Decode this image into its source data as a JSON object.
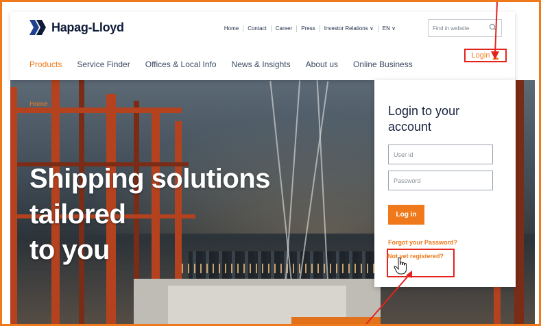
{
  "brand": {
    "name": "Hapag-Lloyd"
  },
  "top_nav": {
    "items": [
      "Home",
      "Contact",
      "Career",
      "Press",
      "Investor Relations ∨"
    ],
    "language": "EN ∨"
  },
  "search": {
    "placeholder": "Find in website",
    "icon": "search-icon"
  },
  "main_nav": {
    "items": [
      "Products",
      "Service Finder",
      "Offices & Local Info",
      "News & Insights",
      "About us",
      "Online Business"
    ],
    "active": "Products"
  },
  "login_link": {
    "label": "Login",
    "icon": "person-icon"
  },
  "hero": {
    "breadcrumb": "Home",
    "title_line1": "Shipping solutions tailored",
    "title_line2": "to you"
  },
  "login_panel": {
    "title": "Login to your account",
    "user_placeholder": "User id",
    "password_placeholder": "Password",
    "login_button": "Log in",
    "forgot_link": "Forgot your Password?",
    "register_link": "Not yet registered?"
  },
  "colors": {
    "accent": "#f07a1b",
    "highlight": "#e5231d",
    "brand_navy": "#0d1b38"
  }
}
